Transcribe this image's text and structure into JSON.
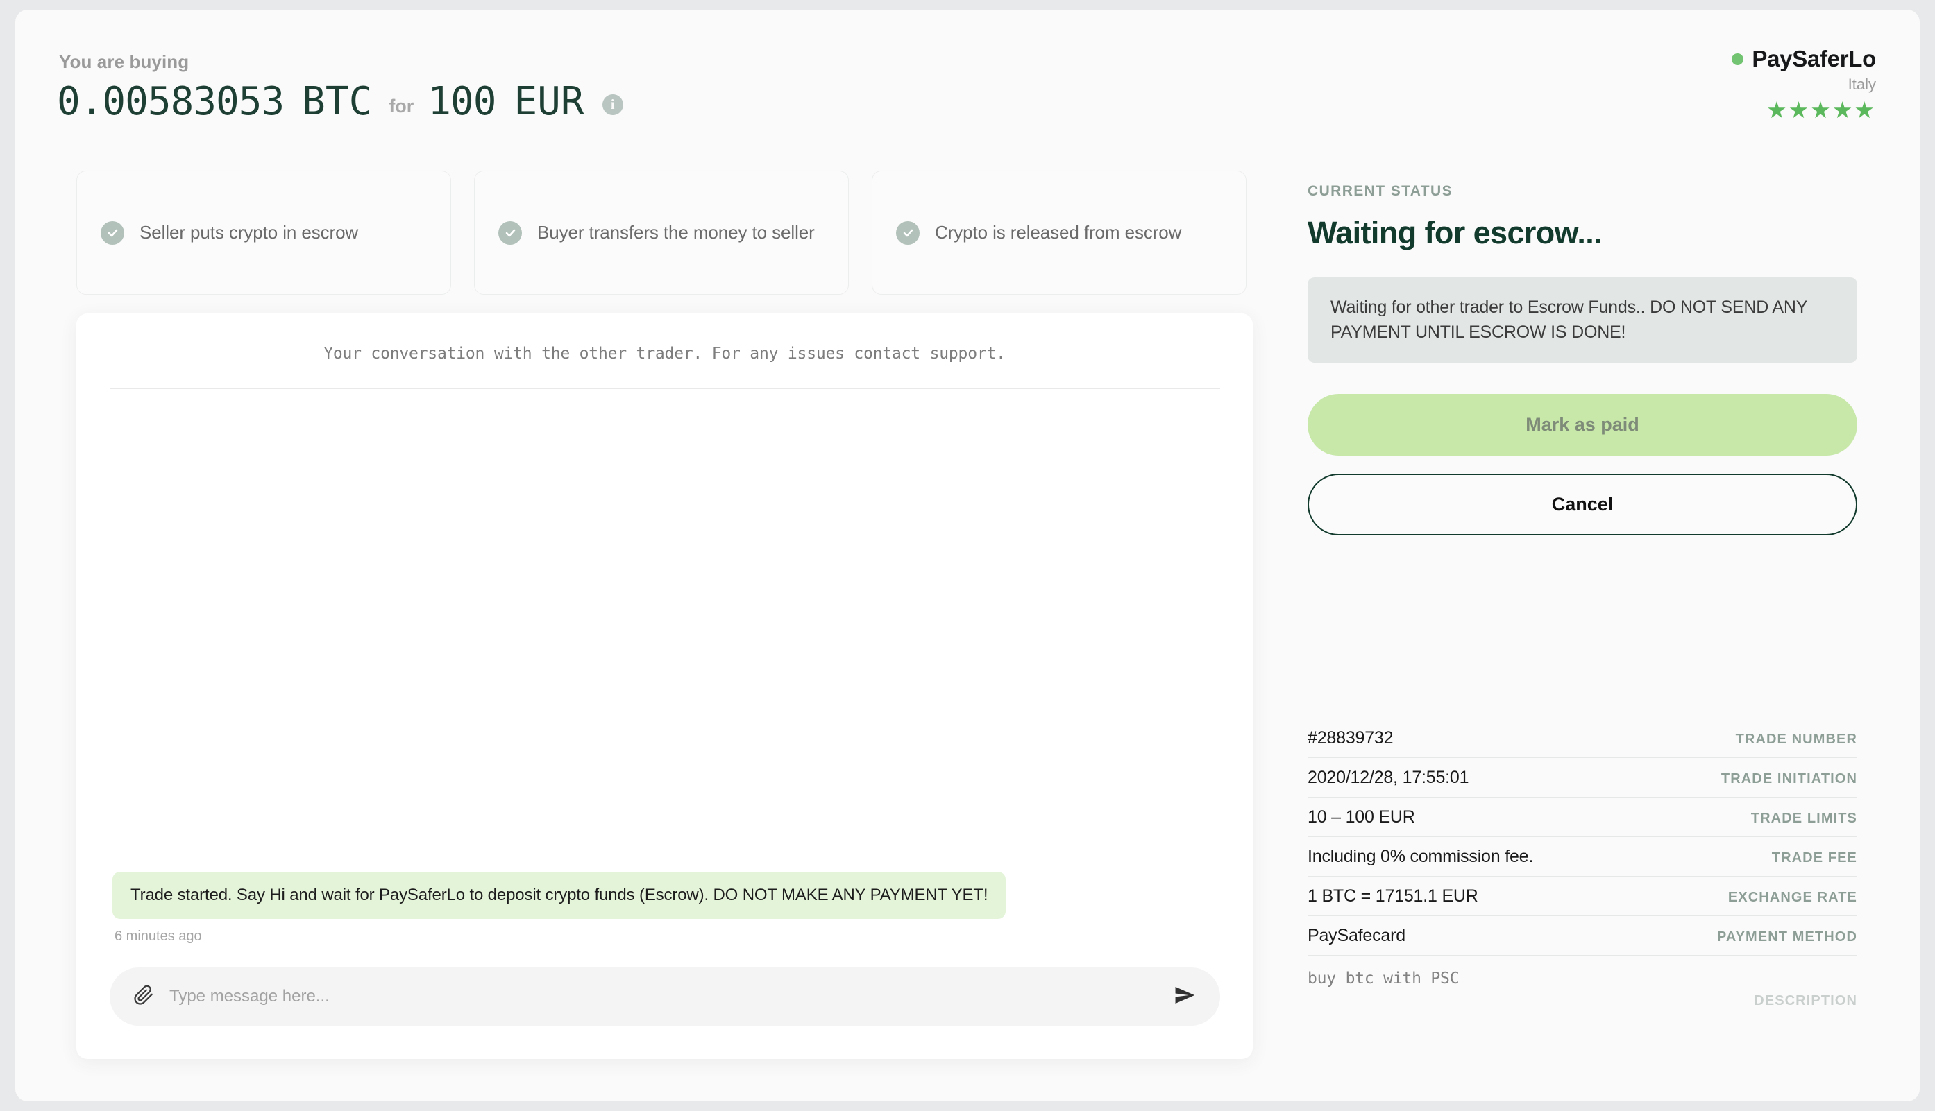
{
  "header": {
    "buying_label": "You are buying",
    "crypto_amount": "0.00583053",
    "crypto_unit": "BTC",
    "for_label": "for",
    "fiat_amount": "100",
    "fiat_unit": "EUR",
    "info_glyph": "i"
  },
  "brand": {
    "name": "PaySaferLo",
    "country": "Italy",
    "stars": "★★★★★",
    "online_dot_color": "#72c472",
    "star_color": "#5cb85c"
  },
  "steps": [
    {
      "label": "Seller puts crypto in escrow"
    },
    {
      "label": "Buyer transfers the money to seller"
    },
    {
      "label": "Crypto is released from escrow"
    }
  ],
  "chat": {
    "header_note": "Your conversation with the other trader. For any issues contact support.",
    "messages": [
      {
        "text": "Trade started. Say Hi and wait for PaySaferLo to deposit crypto funds (Escrow). DO NOT MAKE ANY PAYMENT YET!",
        "time": "6 minutes ago"
      }
    ],
    "input_placeholder": "Type message here...",
    "input_value": ""
  },
  "status": {
    "label": "CURRENT STATUS",
    "title": "Waiting for escrow...",
    "note": "Waiting for other trader to Escrow Funds.. DO NOT SEND ANY PAYMENT UNTIL ESCROW IS DONE!",
    "title_color": "#123a2d"
  },
  "actions": {
    "primary_label": "Mark as paid",
    "secondary_label": "Cancel",
    "primary_color": "#c8e8aa"
  },
  "details": [
    {
      "value": "#28839732",
      "key": "TRADE NUMBER"
    },
    {
      "value": "2020/12/28, 17:55:01",
      "key": "TRADE INITIATION"
    },
    {
      "value": "10 – 100 EUR",
      "key": "TRADE LIMITS"
    },
    {
      "value": "Including 0% commission fee.",
      "key": "TRADE FEE"
    },
    {
      "value": "1 BTC = 17151.1 EUR",
      "key": "EXCHANGE RATE"
    },
    {
      "value": "PaySafecard",
      "key": "PAYMENT METHOD"
    }
  ],
  "description": {
    "value": "buy btc with PSC",
    "key": "DESCRIPTION"
  }
}
